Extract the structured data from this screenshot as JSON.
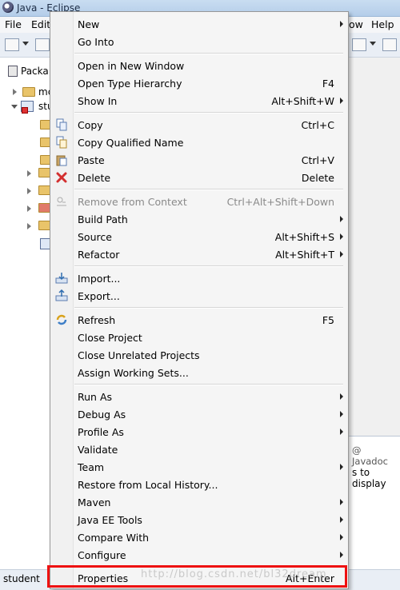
{
  "window": {
    "title": "Java - Eclipse"
  },
  "menubar": {
    "items": [
      "File",
      "Edit",
      "ow",
      "Help"
    ]
  },
  "package_explorer": {
    "tab_label": "Packa",
    "rows": [
      {
        "label": "mc"
      },
      {
        "label": "stu"
      }
    ]
  },
  "javadoc": {
    "tab_label": "Javadoc",
    "text": "s to display"
  },
  "status": {
    "text": "student"
  },
  "watermark": {
    "text": "http://blog.csdn.net/bl32dream"
  },
  "icons": {
    "copy": "copy-icon",
    "copy_qualified": "copy-qualified-icon",
    "paste": "paste-icon",
    "delete": "delete-icon",
    "remove_context": "remove-context-icon",
    "import": "import-icon",
    "export": "export-icon",
    "refresh": "refresh-icon"
  },
  "colors": {
    "highlight": "#e11111",
    "delete_icon": "#d32f2f"
  },
  "context_menu": {
    "new": {
      "label": "New"
    },
    "go_into": {
      "label": "Go Into"
    },
    "open_new_window": {
      "label": "Open in New Window"
    },
    "open_type_hierarchy": {
      "label": "Open Type Hierarchy",
      "shortcut": "F4"
    },
    "show_in": {
      "label": "Show In",
      "shortcut": "Alt+Shift+W"
    },
    "copy": {
      "label": "Copy",
      "shortcut": "Ctrl+C"
    },
    "copy_qualified": {
      "label": "Copy Qualified Name"
    },
    "paste": {
      "label": "Paste",
      "shortcut": "Ctrl+V"
    },
    "delete": {
      "label": "Delete",
      "shortcut": "Delete"
    },
    "remove_context": {
      "label": "Remove from Context",
      "shortcut": "Ctrl+Alt+Shift+Down"
    },
    "build_path": {
      "label": "Build Path"
    },
    "source": {
      "label": "Source",
      "shortcut": "Alt+Shift+S"
    },
    "refactor": {
      "label": "Refactor",
      "shortcut": "Alt+Shift+T"
    },
    "import": {
      "label": "Import..."
    },
    "export": {
      "label": "Export..."
    },
    "refresh": {
      "label": "Refresh",
      "shortcut": "F5"
    },
    "close_project": {
      "label": "Close Project"
    },
    "close_unrelated": {
      "label": "Close Unrelated Projects"
    },
    "assign_working_sets": {
      "label": "Assign Working Sets..."
    },
    "run_as": {
      "label": "Run As"
    },
    "debug_as": {
      "label": "Debug As"
    },
    "profile_as": {
      "label": "Profile As"
    },
    "validate": {
      "label": "Validate"
    },
    "team": {
      "label": "Team"
    },
    "restore_local_history": {
      "label": "Restore from Local History..."
    },
    "maven": {
      "label": "Maven"
    },
    "java_ee_tools": {
      "label": "Java EE Tools"
    },
    "compare_with": {
      "label": "Compare With"
    },
    "configure": {
      "label": "Configure"
    },
    "properties": {
      "label": "Properties",
      "shortcut": "Alt+Enter"
    }
  }
}
